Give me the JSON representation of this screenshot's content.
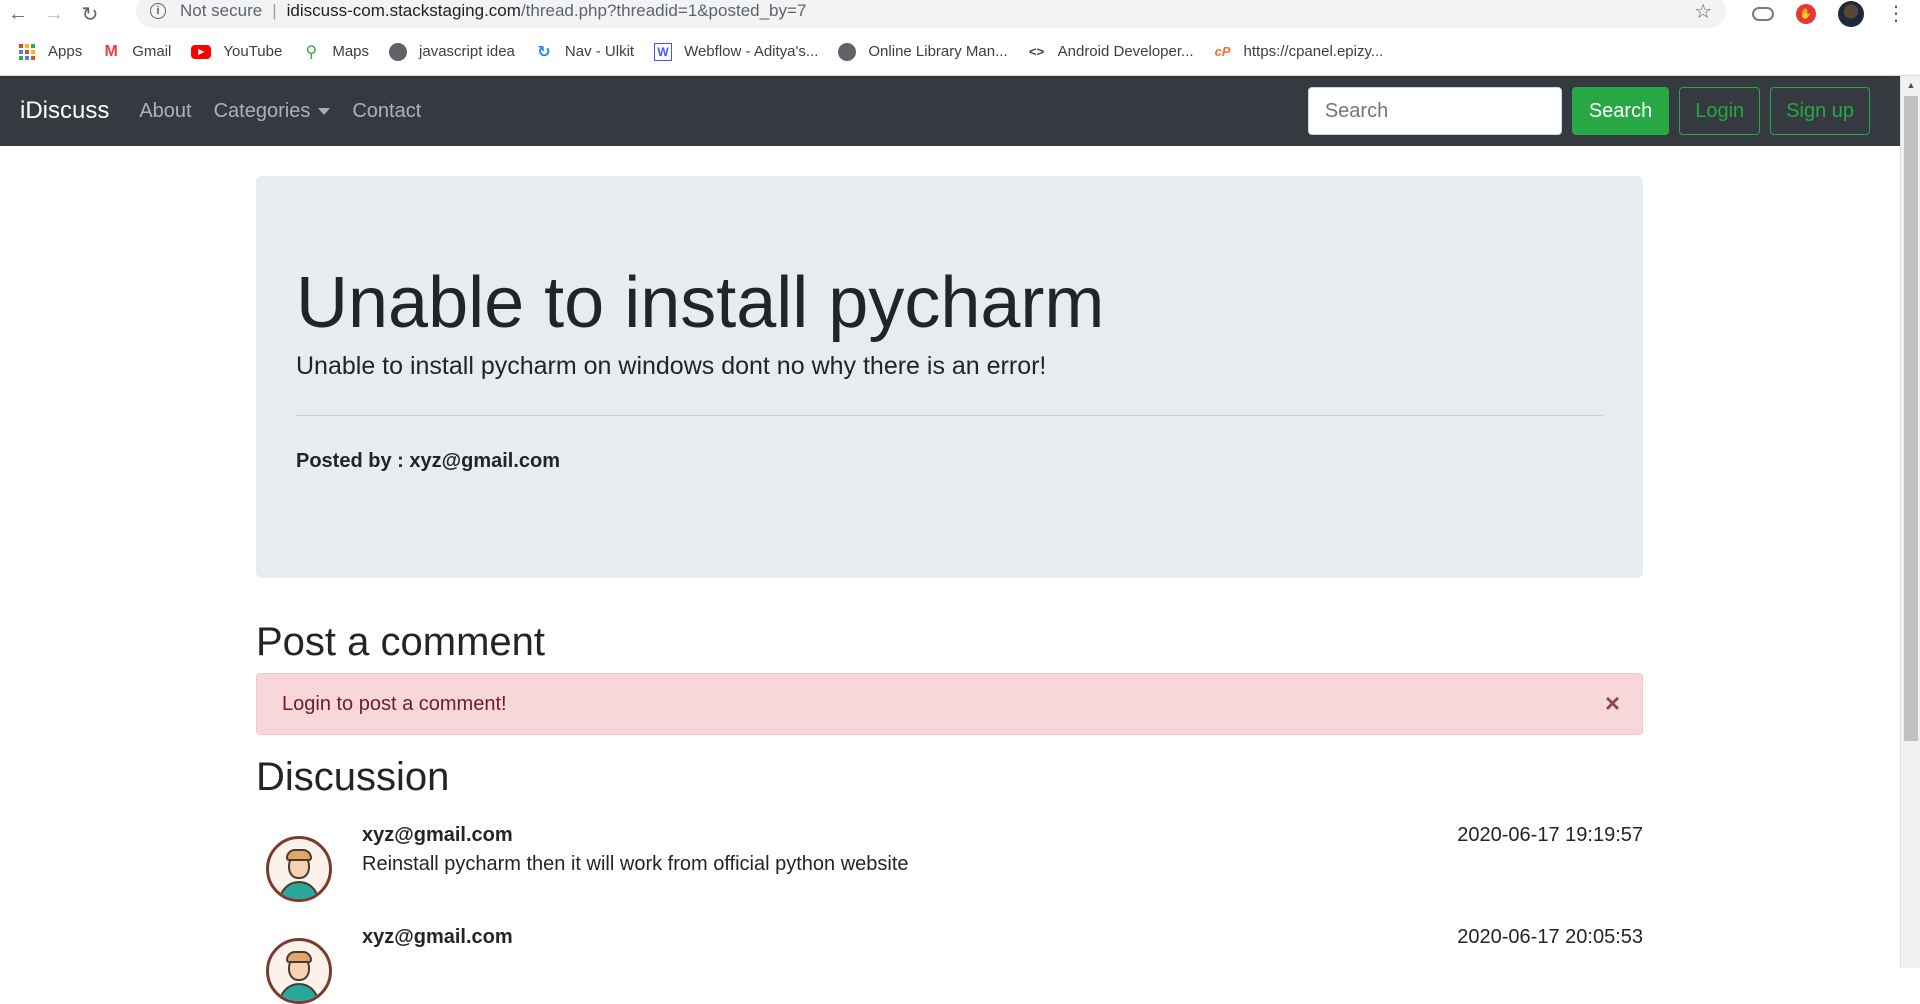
{
  "browser": {
    "security_label": "Not secure",
    "url_host": "idiscuss-com.stackstaging.com",
    "url_path": "/thread.php?threadid=1&posted_by=7",
    "bookmarks": [
      {
        "label": "Apps",
        "icon": "apps-grid-icon"
      },
      {
        "label": "Gmail",
        "icon": "gmail-icon"
      },
      {
        "label": "YouTube",
        "icon": "youtube-icon"
      },
      {
        "label": "Maps",
        "icon": "maps-icon"
      },
      {
        "label": "javascript idea",
        "icon": "globe-icon"
      },
      {
        "label": "Nav - Ulkit",
        "icon": "uikit-icon"
      },
      {
        "label": "Webflow - Aditya's...",
        "icon": "webflow-icon"
      },
      {
        "label": "Online Library Man...",
        "icon": "globe-icon"
      },
      {
        "label": "Android Developer...",
        "icon": "code-icon"
      },
      {
        "label": "https://cpanel.epizy...",
        "icon": "cpanel-icon"
      }
    ]
  },
  "navbar": {
    "brand": "iDiscuss",
    "links": [
      "About",
      "Categories",
      "Contact"
    ],
    "search_placeholder": "Search",
    "search_button": "Search",
    "login_button": "Login",
    "signup_button": "Sign up"
  },
  "thread": {
    "title": "Unable to install pycharm",
    "description": "Unable to install pycharm on windows dont no why there is an error!",
    "posted_by": "Posted by : xyz@gmail.com"
  },
  "post_comment": {
    "heading": "Post a comment",
    "alert": "Login to post a comment!",
    "close_symbol": "×"
  },
  "discussion": {
    "heading": "Discussion",
    "comments": [
      {
        "user": "xyz@gmail.com",
        "text": "Reinstall pycharm then it will work from official python website",
        "time": "2020-06-17 19:19:57"
      },
      {
        "user": "xyz@gmail.com",
        "text": "",
        "time": "2020-06-17 20:05:53"
      }
    ]
  },
  "colors": {
    "navbar_bg": "#343a40",
    "success": "#28a745",
    "jumbotron_bg": "#e9ecef",
    "alert_bg": "#f8d7da",
    "alert_text": "#721c24"
  }
}
